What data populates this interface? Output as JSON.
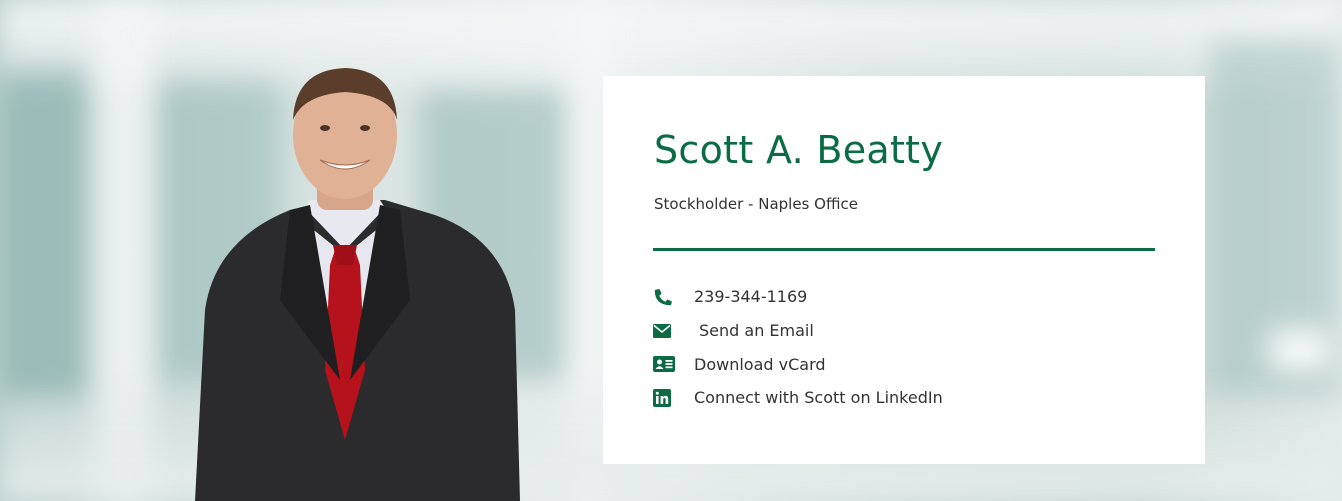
{
  "profile": {
    "name": "Scott A. Beatty",
    "title": "Stockholder - Naples Office"
  },
  "contacts": [
    {
      "icon": "phone-icon",
      "label": "239-344-1169"
    },
    {
      "icon": "envelope-icon",
      "label": "Send an Email"
    },
    {
      "icon": "vcard-icon",
      "label": "Download vCard"
    },
    {
      "icon": "linkedin-icon",
      "label": "Connect with Scott on LinkedIn"
    }
  ],
  "colors": {
    "accent": "#0a6b45",
    "text": "#333333",
    "card": "#ffffff"
  }
}
